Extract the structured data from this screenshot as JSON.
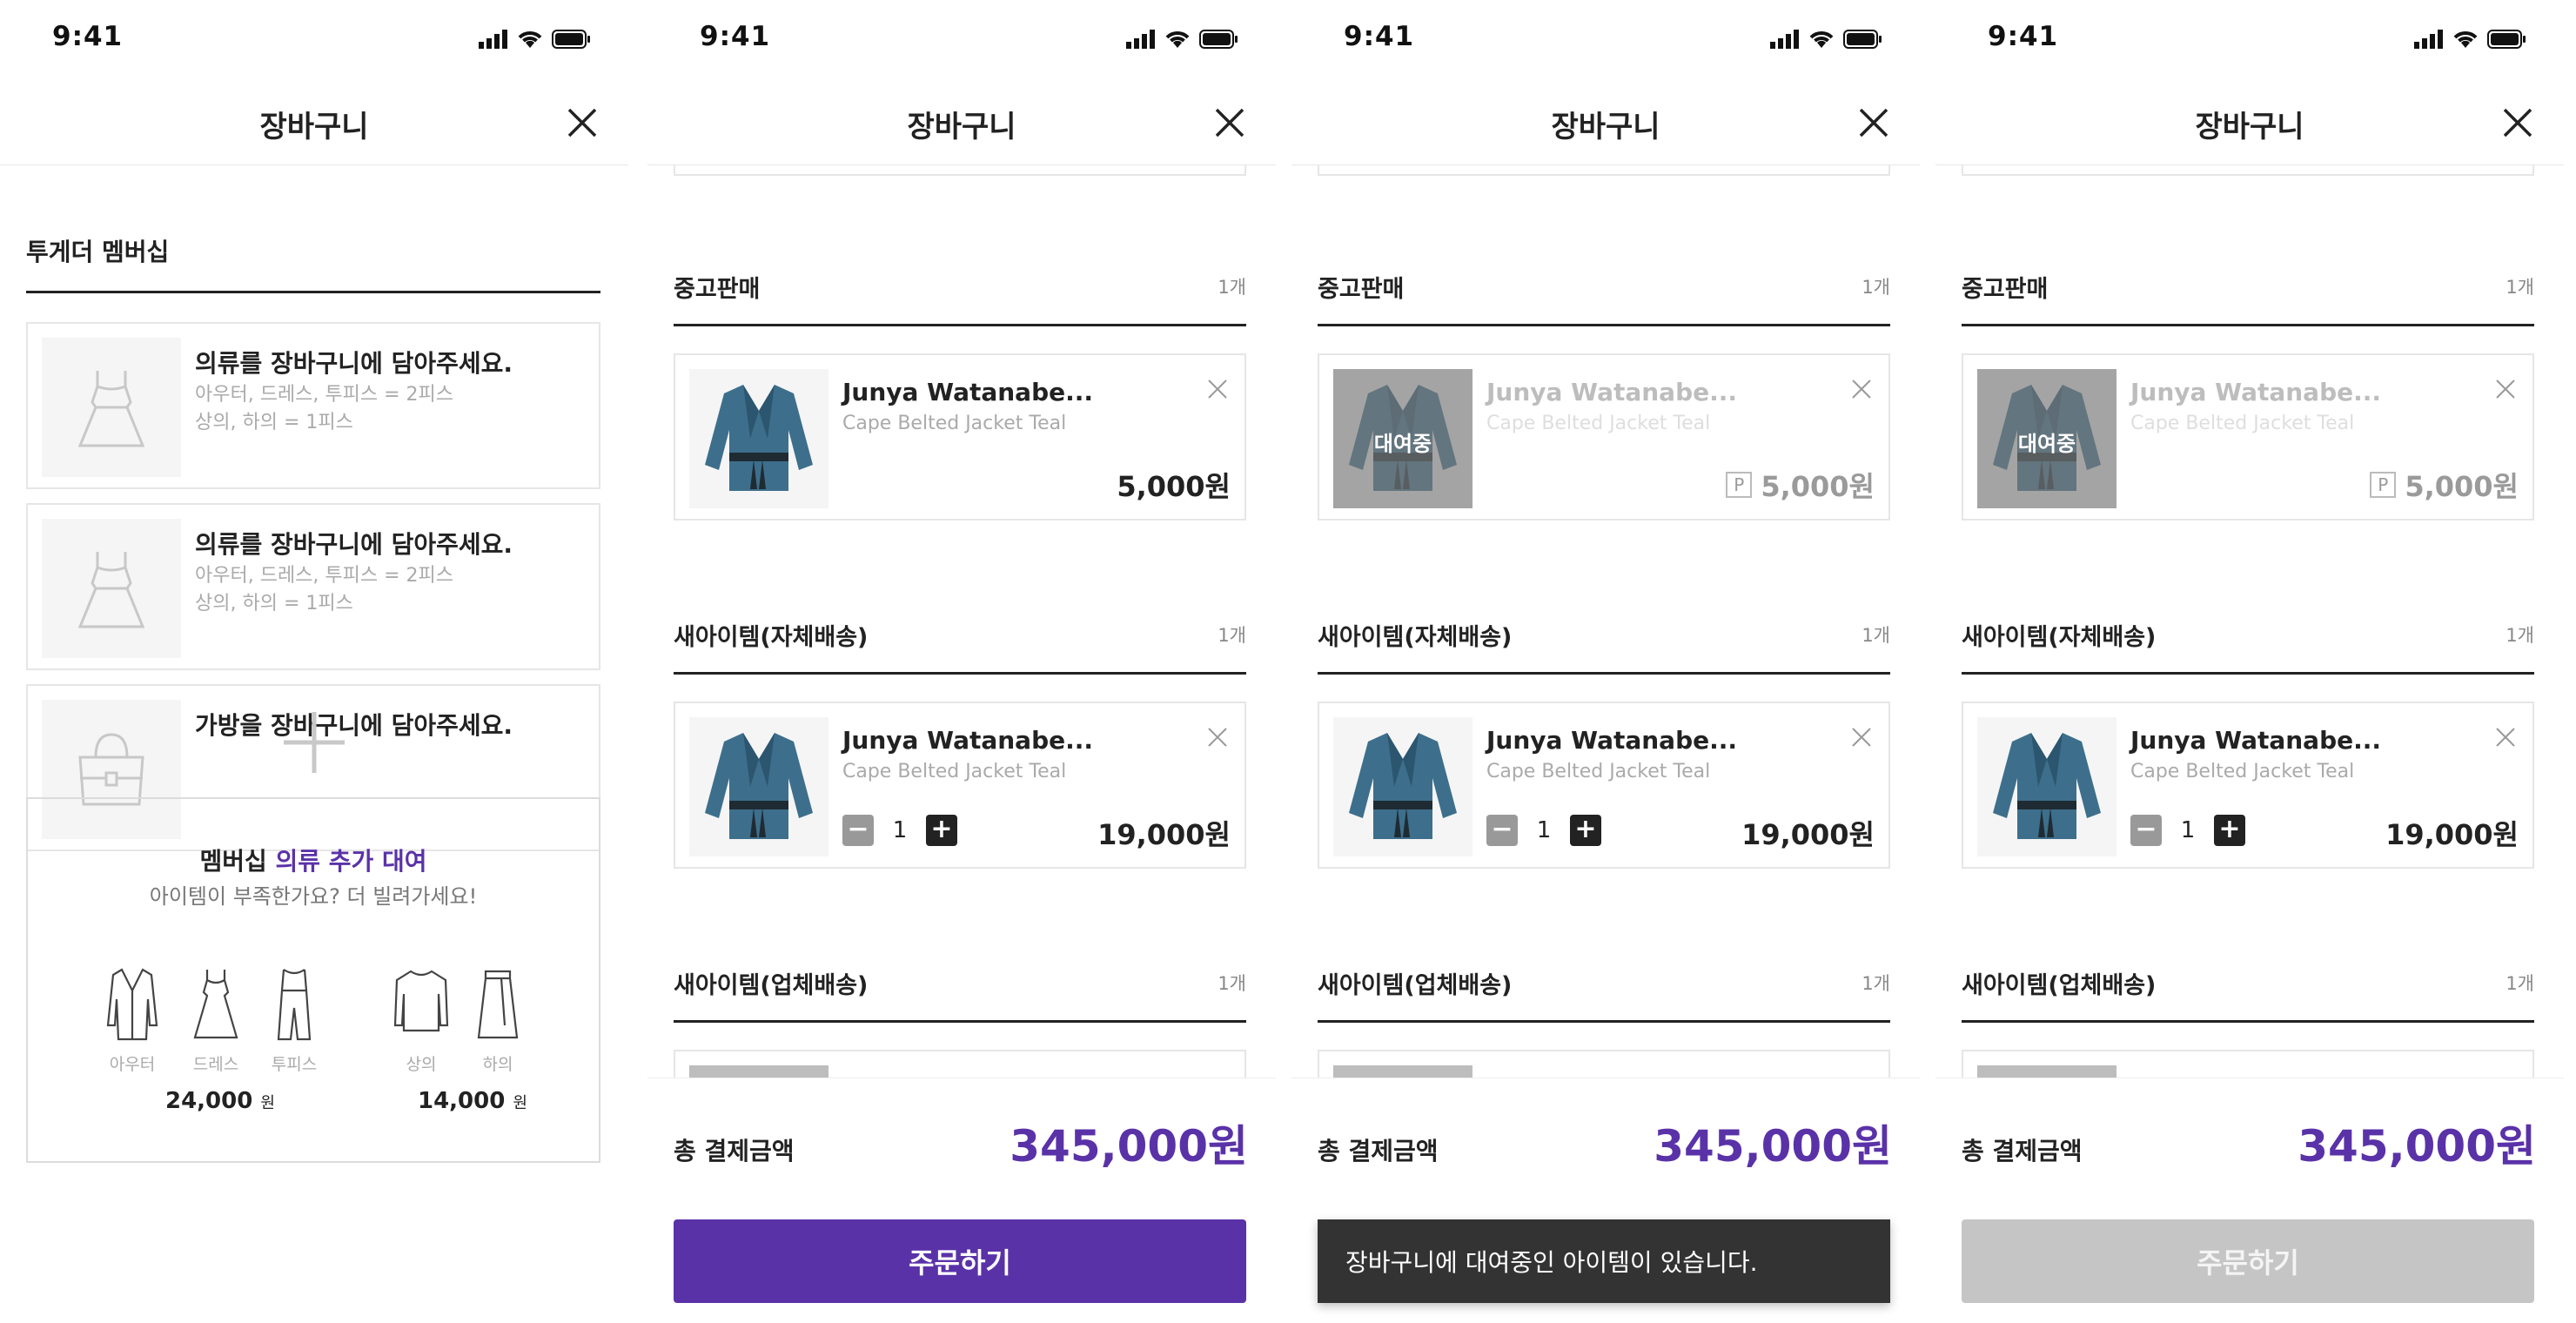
{
  "status": {
    "time": "9:41"
  },
  "header": {
    "title": "장바구니"
  },
  "screen1": {
    "section_title": "투게더 멤버십",
    "slots": [
      {
        "title": "의류를 장바구니에 담아주세요.",
        "desc1": "아우터, 드레스, 투피스 = 2피스",
        "desc2": "상의, 하의 = 1피스",
        "icon": "dress-icon"
      },
      {
        "title": "의류를 장바구니에 담아주세요.",
        "desc1": "아우터, 드레스, 투피스 = 2피스",
        "desc2": "상의, 하의 = 1피스",
        "icon": "dress-icon"
      },
      {
        "title": "가방을 장바구니에 담아주세요.",
        "desc1": "",
        "desc2": "",
        "icon": "bag-icon"
      }
    ],
    "promo": {
      "title_prefix": "멤버십 ",
      "title_highlight": "의류 추가 대여",
      "subtitle": "아이템이 부족한가요? 더 빌려가세요!",
      "items": [
        {
          "label": "아우터",
          "icon": "coat-icon"
        },
        {
          "label": "드레스",
          "icon": "dress-icon"
        },
        {
          "label": "투피스",
          "icon": "jumpsuit-icon"
        },
        {
          "label": "상의",
          "icon": "shirt-icon"
        },
        {
          "label": "하의",
          "icon": "skirt-icon"
        }
      ],
      "price_a": "24,000",
      "price_b": "14,000",
      "won": "원"
    }
  },
  "sections": {
    "used": {
      "title": "중고판매",
      "count": "1개"
    },
    "new_self": {
      "title": "새아이템(자체배송)",
      "count": "1개"
    },
    "new_vendor": {
      "title": "새아이템(업체배송)",
      "count": "1개"
    }
  },
  "product": {
    "name": "Junya Watanabe...",
    "subtitle": "Cape Belted Jacket Teal",
    "used_price": "5,000원",
    "new_price": "19,000원",
    "quantity": "1",
    "rent_label": "대여중",
    "point_badge": "P",
    "jacket_color": "#3d6f8c"
  },
  "footer": {
    "total_label": "총 결제금액",
    "total_value": "345,000원",
    "order_label": "주문하기",
    "toast": "장바구니에 대여중인 아이템이 있습니다."
  },
  "colors": {
    "accent": "#5a32a8",
    "disabled": "#c5c5c5",
    "toast": "#333333"
  }
}
